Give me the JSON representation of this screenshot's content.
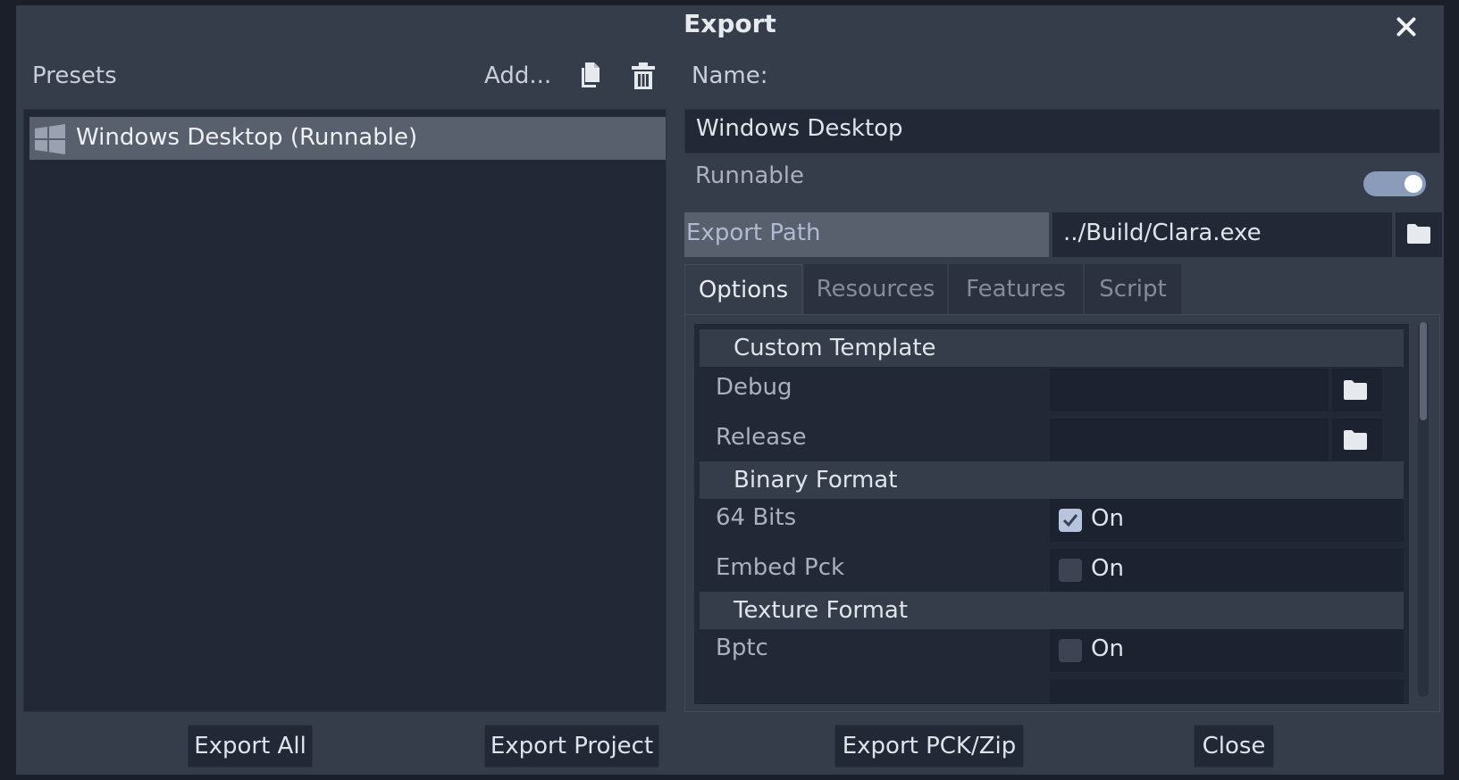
{
  "dialog": {
    "title": "Export"
  },
  "presets": {
    "label": "Presets",
    "add_label": "Add...",
    "items": [
      {
        "label": "Windows Desktop (Runnable)"
      }
    ]
  },
  "details": {
    "name_label": "Name:",
    "name_value": "Windows Desktop",
    "runnable_label": "Runnable",
    "runnable_on": true,
    "export_path_label": "Export Path",
    "export_path_value": "../Build/Clara.exe"
  },
  "tabs": [
    {
      "label": "Options",
      "active": true
    },
    {
      "label": "Resources",
      "active": false
    },
    {
      "label": "Features",
      "active": false
    },
    {
      "label": "Script",
      "active": false
    }
  ],
  "options": {
    "custom_template": "Custom Template",
    "debug_label": "Debug",
    "release_label": "Release",
    "binary_format": "Binary Format",
    "bits64_label": "64 Bits",
    "bits64_value": "On",
    "embed_pck_label": "Embed Pck",
    "embed_pck_value": "On",
    "texture_format": "Texture Format",
    "bptc_label": "Bptc",
    "bptc_value": "On"
  },
  "footer": {
    "export_all": "Export All",
    "export_project": "Export Project",
    "export_pck_zip": "Export PCK/Zip",
    "close": "Close"
  },
  "colors": {
    "dialog_bg": "#363d4a",
    "panel_bg": "#222836",
    "selected_bg": "#59606d",
    "accent": "#8a9cba"
  }
}
